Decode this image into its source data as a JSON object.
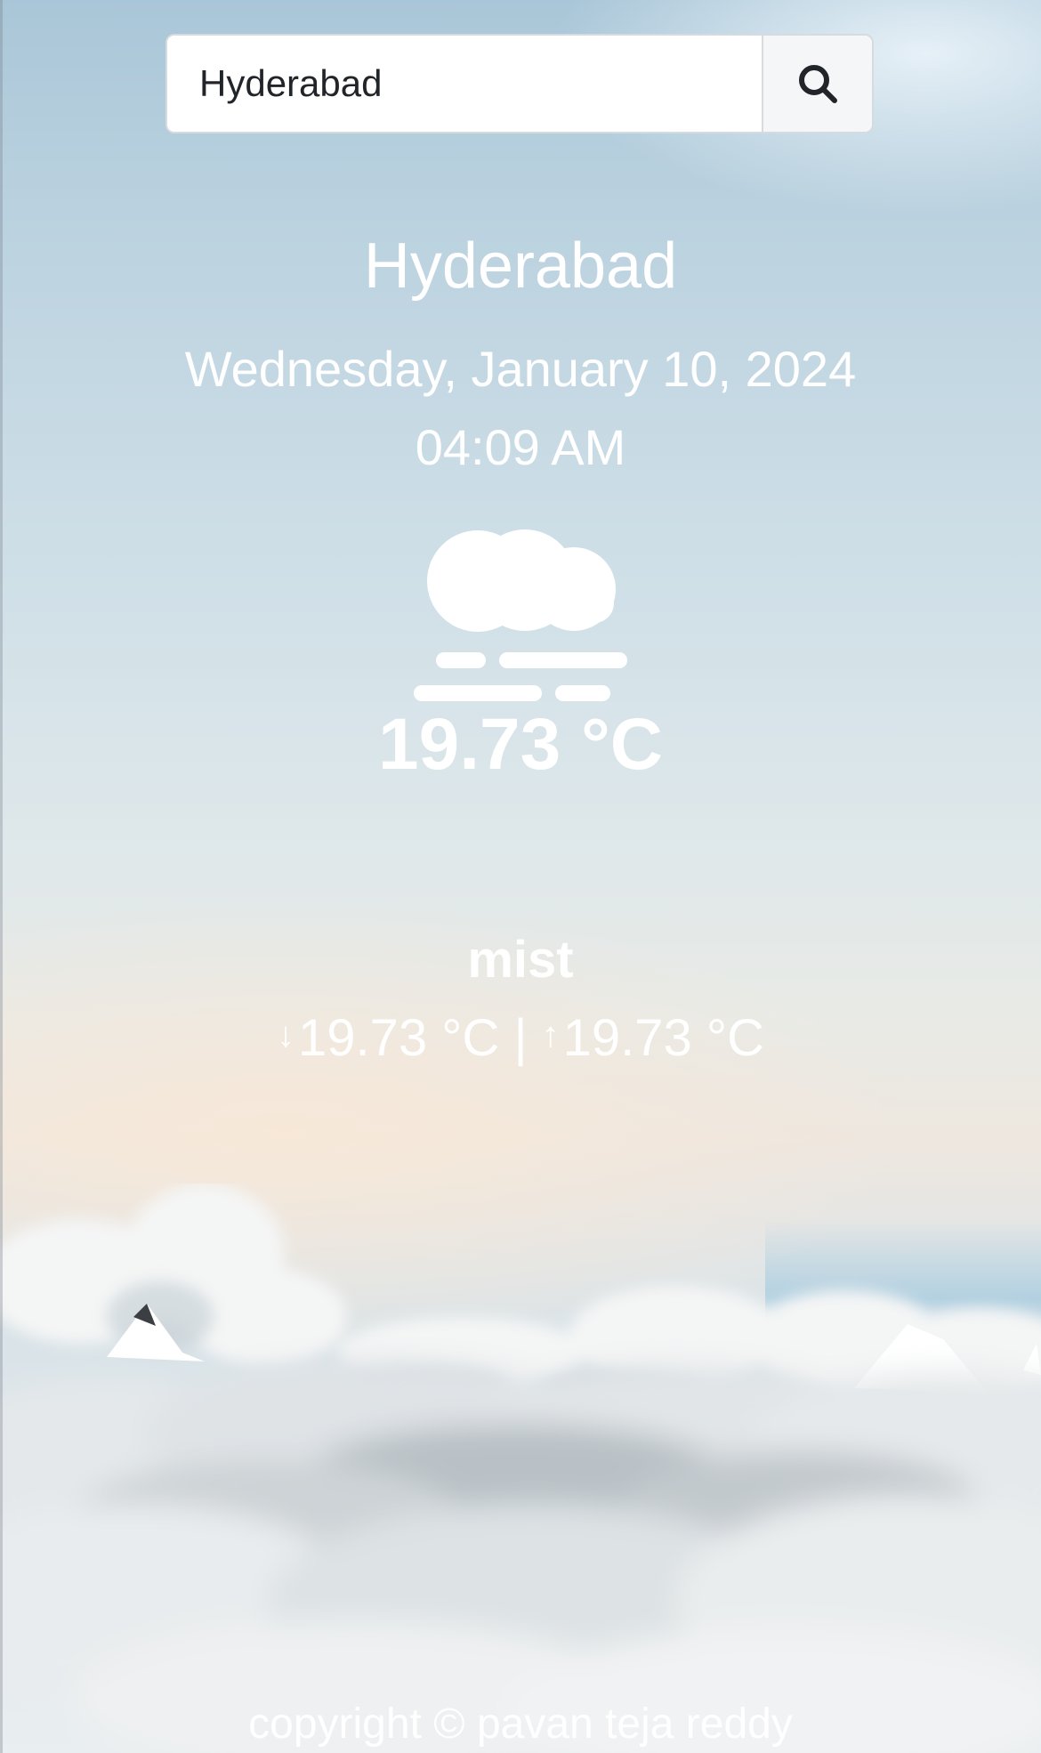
{
  "search": {
    "value": "Hyderabad",
    "button_icon": "search-icon"
  },
  "weather": {
    "city": "Hyderabad",
    "date": "Wednesday, January 10, 2024",
    "time": "04:09 AM",
    "icon": "mist-icon",
    "temperature": "19.73 °C",
    "description": "mist",
    "min_temp": "19.73 °C",
    "separator": "|",
    "max_temp": "19.73 °C",
    "min_arrow": "↓",
    "max_arrow": "↑"
  },
  "footer": {
    "text": "copyright © pavan teja reddy"
  },
  "colors": {
    "text": "#ffffff",
    "input_text": "#212529",
    "input_border": "#d6dbe0",
    "button_bg": "#f5f6f7"
  }
}
